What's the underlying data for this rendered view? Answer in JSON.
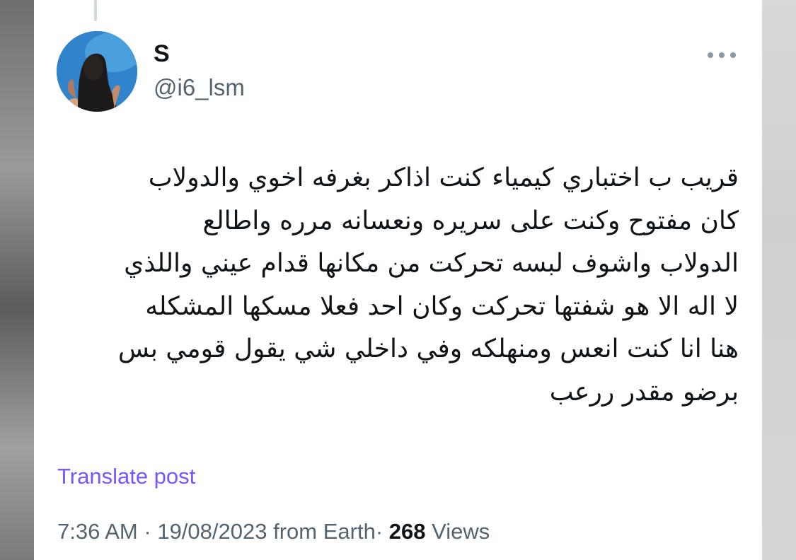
{
  "post": {
    "author": {
      "display_name": "S",
      "handle": "@i6_lsm",
      "avatar_icon": "profile-photo"
    },
    "more_icon": "more-horizontal-icon",
    "text_lines": [
      "قريب ب اختباري كيمياء كنت اذاكر بغرفه اخوي والدولاب",
      "كان مفتوح وكنت على سريره ونعسانه مرره واطالع",
      "الدولاب واشوف لبسه تحركت من مكانها قدام عيني واللذي",
      "لا اله الا هو شفتها تحركت وكان احد فعلا مسكها المشكله",
      "هنا انا كنت انعس ومنهلكه وفي داخلي شي يقول قومي بس",
      "برضو مقدر ررعب"
    ],
    "translate_label": "Translate post",
    "meta": {
      "time": "7:36 AM",
      "separator": "·",
      "date": "19/08/2023",
      "source": "from Earth",
      "views_count": "268",
      "views_label": "Views"
    }
  },
  "colors": {
    "text_primary": "#0f1419",
    "text_secondary": "#536471",
    "link": "#7856ff"
  }
}
